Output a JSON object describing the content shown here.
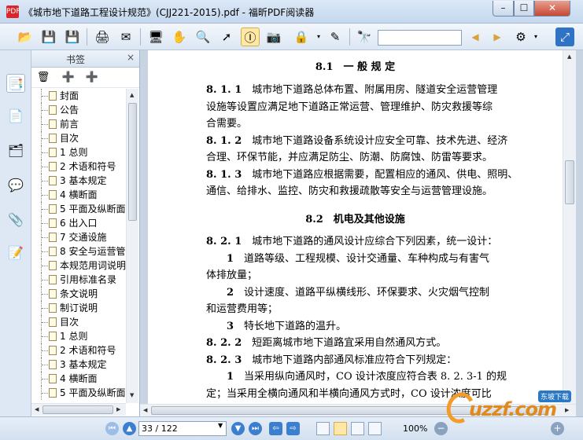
{
  "window": {
    "title": "《城市地下道路工程设计规范》(CJJ221-2015).pdf - 福昕PDF阅读器",
    "app_icon_text": "PDF",
    "min_label": "–",
    "max_label": "☐",
    "close_label": "✕"
  },
  "toolbar": {
    "buttons": [
      {
        "name": "open",
        "glyph": "📂"
      },
      {
        "name": "save",
        "glyph": "💾"
      },
      {
        "name": "save-all",
        "glyph": "💾"
      },
      {
        "name": "print",
        "glyph": "🖨"
      },
      {
        "name": "email",
        "glyph": "✉"
      },
      {
        "name": "fullscreen",
        "glyph": "🖥"
      },
      {
        "name": "hand",
        "glyph": "✋"
      },
      {
        "name": "zoom",
        "glyph": "🔍"
      },
      {
        "name": "select",
        "glyph": "➚"
      },
      {
        "name": "text-select",
        "glyph": "Ⓘ"
      },
      {
        "name": "snapshot",
        "glyph": "📷"
      },
      {
        "name": "rms",
        "glyph": "🔒"
      },
      {
        "name": "sign",
        "glyph": "✎"
      },
      {
        "name": "find",
        "glyph": "🔭"
      },
      {
        "name": "find-prev",
        "glyph": "◀"
      },
      {
        "name": "find-next",
        "glyph": "▶"
      },
      {
        "name": "options",
        "glyph": "⚙"
      },
      {
        "name": "minimize-ribbon",
        "glyph": "⤢"
      }
    ],
    "search_value": ""
  },
  "sidebar_strip": {
    "icons": [
      "bookmark-icon",
      "pages-icon",
      "layers-icon",
      "comments-icon",
      "attachments-icon",
      "signatures-icon"
    ],
    "glyphs": [
      "📑",
      "📄",
      "🗂",
      "💬",
      "📎",
      "📝"
    ]
  },
  "bookmarks": {
    "title": "书签",
    "close": "×",
    "tools": [
      "🗑",
      "➕",
      "➕"
    ],
    "items": [
      "封面",
      "公告",
      "前言",
      "目次",
      "1 总则",
      "2 术语和符号",
      "3 基本规定",
      "4 横断面",
      "5 平面及纵断面",
      "6 出入口",
      "7 交通设施",
      "8 安全与运营管",
      "本规范用词说明",
      "引用标准名录",
      "条文说明",
      "制订说明",
      "目次",
      "1 总则",
      "2 术语和符号",
      "3 基本规定",
      "4 横断面",
      "5 平面及纵断面"
    ]
  },
  "document": {
    "heading1": "8.1　一 般 规 定",
    "heading2": "8.2　机电及其他设施",
    "lines": [
      [
        {
          "t": "8. 1. 1",
          "b": true
        },
        {
          "t": "　城市地下道路总体布置、附属用房、隧道安全运营管理"
        }
      ],
      [
        {
          "t": "设施等设置应满足地下道路正常运营、管理维护、防灾救援等综"
        }
      ],
      [
        {
          "t": "合需要。"
        }
      ],
      [
        {
          "t": "8. 1. 2",
          "b": true
        },
        {
          "t": "　城市地下道路设备系统设计应安全可靠、技术先进、经济"
        }
      ],
      [
        {
          "t": "合理、环保节能，并应满足防尘、防潮、防腐蚀、防雷等要求。"
        }
      ],
      [
        {
          "t": "8. 1. 3",
          "b": true
        },
        {
          "t": "　城市地下道路应根据需要，配置相应的通风、供电、照明、"
        }
      ],
      [
        {
          "t": "通信、给排水、监控、防灾和救援疏散等安全与运营管理设施。"
        }
      ]
    ],
    "lines2": [
      [
        {
          "t": "8. 2. 1",
          "b": true
        },
        {
          "t": "　城市地下道路的通风设计应综合下列因素，统一设计："
        }
      ],
      [
        {
          "t": "　　1",
          "b": true
        },
        {
          "t": "　道路等级、工程规模、设计交通量、车种构成与有害气"
        }
      ],
      [
        {
          "t": "体排放量；"
        }
      ],
      [
        {
          "t": "　　2",
          "b": true
        },
        {
          "t": "　设计速度、道路平纵横线形、环保要求、火灾烟气控制"
        }
      ],
      [
        {
          "t": "和运营费用等；"
        }
      ],
      [
        {
          "t": "　　3",
          "b": true
        },
        {
          "t": "　特长地下道路的温升。"
        }
      ],
      [
        {
          "t": "8. 2. 2",
          "b": true
        },
        {
          "t": "　短距离城市地下道路宜采用自然通风方式。"
        }
      ],
      [
        {
          "t": "8. 2. 3",
          "b": true
        },
        {
          "t": "　城市地下道路内部通风标准应符合下列规定："
        }
      ],
      [
        {
          "t": "　　1",
          "b": true
        },
        {
          "t": "　当采用纵向通风时，CO 设计浓度应符合表 8. 2. 3-1 的规"
        }
      ],
      [
        {
          "t": "定；当采用全横向通风和半横向通风方式时，CO 设计浓度可比"
        }
      ]
    ]
  },
  "statusbar": {
    "page_display": "33 / 122",
    "zoom": "100%",
    "zoom_out": "−",
    "zoom_in": "+"
  },
  "watermark": {
    "text": "uzzf.com",
    "badge": "东坡下载"
  }
}
